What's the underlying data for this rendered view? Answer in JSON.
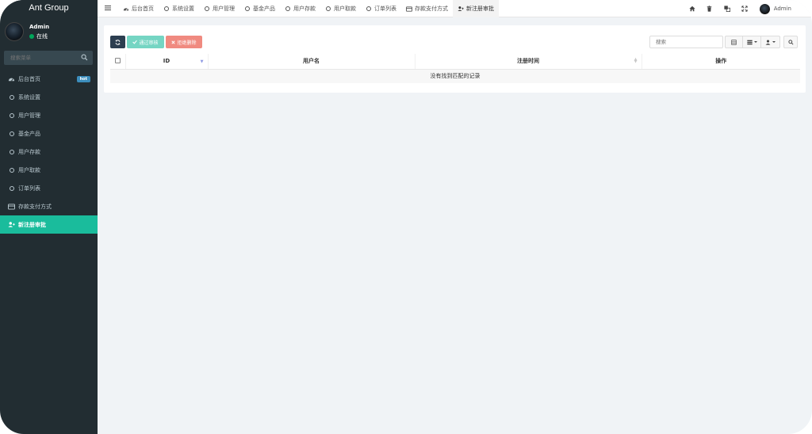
{
  "brand": "Ant Group",
  "user": {
    "name": "Admin",
    "status": "在线"
  },
  "sidebar": {
    "search_placeholder": "搜索菜单",
    "items": [
      {
        "label": "后台首页",
        "icon": "dashboard-icon",
        "badge": "hot"
      },
      {
        "label": "系统设置",
        "icon": "circle-icon"
      },
      {
        "label": "用户管理",
        "icon": "circle-icon"
      },
      {
        "label": "基金产品",
        "icon": "circle-icon"
      },
      {
        "label": "用户存款",
        "icon": "circle-icon"
      },
      {
        "label": "用户取款",
        "icon": "circle-icon"
      },
      {
        "label": "订单列表",
        "icon": "circle-icon"
      },
      {
        "label": "存款支付方式",
        "icon": "credit-card-icon"
      },
      {
        "label": "新注册审批",
        "icon": "user-plus-icon",
        "active": true
      }
    ]
  },
  "tabs": [
    {
      "label": "后台首页",
      "icon": "dashboard-icon"
    },
    {
      "label": "系统设置",
      "icon": "circle-icon"
    },
    {
      "label": "用户管理",
      "icon": "circle-icon"
    },
    {
      "label": "基金产品",
      "icon": "circle-icon"
    },
    {
      "label": "用户存款",
      "icon": "circle-icon"
    },
    {
      "label": "用户取款",
      "icon": "circle-icon"
    },
    {
      "label": "订单列表",
      "icon": "circle-icon"
    },
    {
      "label": "存款支付方式",
      "icon": "credit-card-icon"
    },
    {
      "label": "新注册审批",
      "icon": "user-plus-icon",
      "active": true
    }
  ],
  "topbar": {
    "user_name": "Admin"
  },
  "toolbar": {
    "approve_label": "通过审核",
    "reject_label": "拒绝删除"
  },
  "table": {
    "search_placeholder": "搜索",
    "columns": [
      "ID",
      "用户名",
      "注册时间",
      "操作"
    ],
    "empty_text": "没有找到匹配的记录"
  },
  "colors": {
    "sidebar_bg": "#222d32",
    "active_menu": "#1abc9c",
    "approve_button": "#75d5c3",
    "reject_button": "#f08a80",
    "refresh_button": "#2c3e50",
    "hot_badge": "#3c8dbc"
  }
}
